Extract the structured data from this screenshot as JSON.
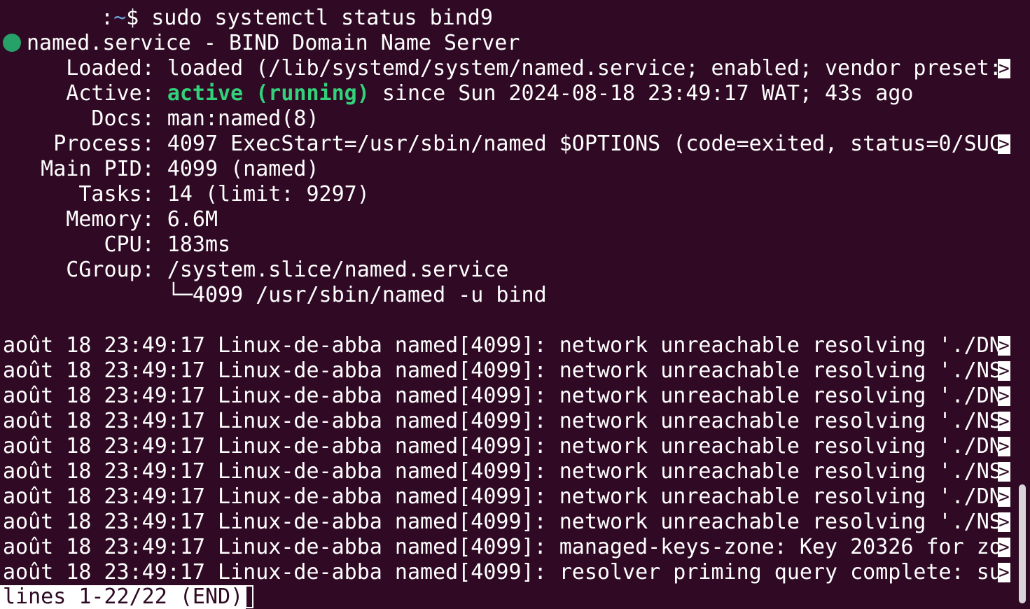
{
  "terminal": {
    "prompt_user": "",
    "prompt_sep": ":",
    "prompt_path": "~",
    "prompt_symbol": "$",
    "command": "sudo systemctl status bind9",
    "service_title": "named.service - BIND Domain Name Server",
    "loaded": "     Loaded: loaded (/lib/systemd/system/named.service; enabled; vendor preset:",
    "active_label": "     Active: ",
    "active_state": "active (running)",
    "active_rest": " since Sun 2024-08-18 23:49:17 WAT; 43s ago",
    "docs": "       Docs: man:named(8)",
    "process": "    Process: 4097 ExecStart=/usr/sbin/named $OPTIONS (code=exited, status=0/SUC",
    "main_pid": "   Main PID: 4099 (named)",
    "tasks": "      Tasks: 14 (limit: 9297)",
    "memory": "     Memory: 6.6M",
    "cpu": "        CPU: 183ms",
    "cgroup": "     CGroup: /system.slice/named.service",
    "cgroup_child": "             └─4099 /usr/sbin/named -u bind",
    "truncation_marker": ">",
    "log_lines": [
      "août 18 23:49:17 Linux-de-abba named[4099]: network unreachable resolving './DN",
      "août 18 23:49:17 Linux-de-abba named[4099]: network unreachable resolving './NS",
      "août 18 23:49:17 Linux-de-abba named[4099]: network unreachable resolving './DN",
      "août 18 23:49:17 Linux-de-abba named[4099]: network unreachable resolving './NS",
      "août 18 23:49:17 Linux-de-abba named[4099]: network unreachable resolving './DN",
      "août 18 23:49:17 Linux-de-abba named[4099]: network unreachable resolving './NS",
      "août 18 23:49:17 Linux-de-abba named[4099]: network unreachable resolving './DN",
      "août 18 23:49:17 Linux-de-abba named[4099]: network unreachable resolving './NS",
      "août 18 23:49:17 Linux-de-abba named[4099]: managed-keys-zone: Key 20326 for zo",
      "août 18 23:49:17 Linux-de-abba named[4099]: resolver priming query complete: su"
    ],
    "pager_status": "lines 1-22/22 (END)"
  },
  "colors": {
    "background": "#300a24",
    "foreground": "#ffffff",
    "active_green": "#33d17a",
    "status_dot": "#26a269",
    "prompt_path": "#6f9fd8"
  }
}
